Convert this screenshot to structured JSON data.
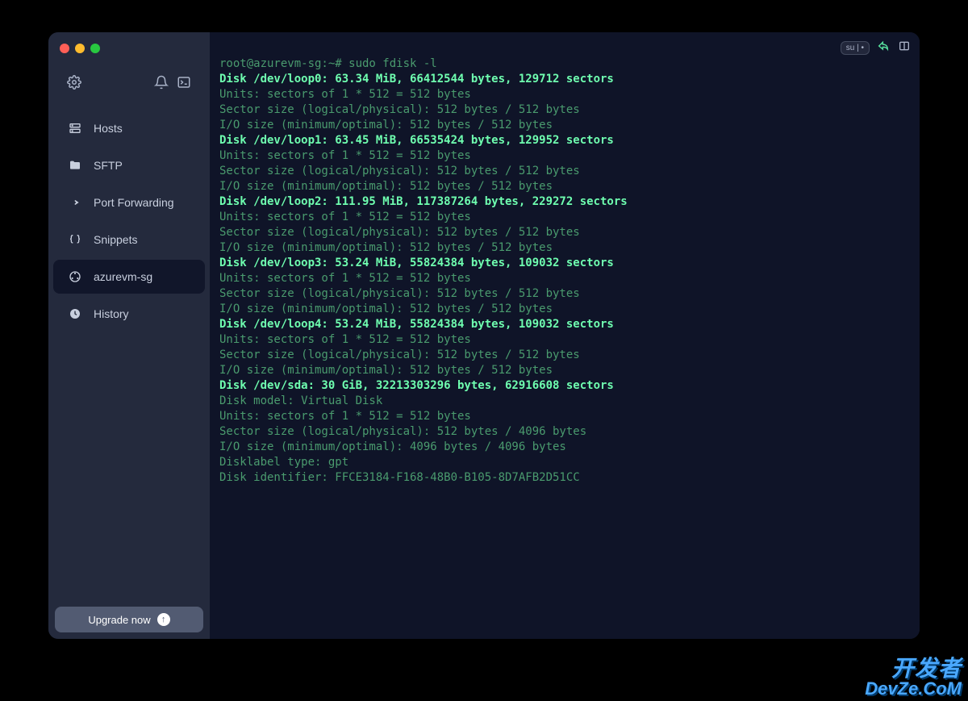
{
  "sidebar": {
    "items": [
      {
        "id": "hosts",
        "label": "Hosts"
      },
      {
        "id": "sftp",
        "label": "SFTP"
      },
      {
        "id": "port-forwarding",
        "label": "Port Forwarding"
      },
      {
        "id": "snippets",
        "label": "Snippets"
      },
      {
        "id": "session",
        "label": "azurevm-sg"
      },
      {
        "id": "history",
        "label": "History"
      }
    ],
    "upgrade_label": "Upgrade now"
  },
  "toolbar": {
    "chip_label": "su | •"
  },
  "terminal": {
    "prompt": "root@azurevm-sg:~# sudo fdisk -l",
    "blocks": [
      {
        "header": "Disk /dev/loop0: 63.34 MiB, 66412544 bytes, 129712 sectors",
        "lines": [
          "Units: sectors of 1 * 512 = 512 bytes",
          "Sector size (logical/physical): 512 bytes / 512 bytes",
          "I/O size (minimum/optimal): 512 bytes / 512 bytes"
        ]
      },
      {
        "header": "Disk /dev/loop1: 63.45 MiB, 66535424 bytes, 129952 sectors",
        "lines": [
          "Units: sectors of 1 * 512 = 512 bytes",
          "Sector size (logical/physical): 512 bytes / 512 bytes",
          "I/O size (minimum/optimal): 512 bytes / 512 bytes"
        ]
      },
      {
        "header": "Disk /dev/loop2: 111.95 MiB, 117387264 bytes, 229272 sectors",
        "lines": [
          "Units: sectors of 1 * 512 = 512 bytes",
          "Sector size (logical/physical): 512 bytes / 512 bytes",
          "I/O size (minimum/optimal): 512 bytes / 512 bytes"
        ]
      },
      {
        "header": "Disk /dev/loop3: 53.24 MiB, 55824384 bytes, 109032 sectors",
        "lines": [
          "Units: sectors of 1 * 512 = 512 bytes",
          "Sector size (logical/physical): 512 bytes / 512 bytes",
          "I/O size (minimum/optimal): 512 bytes / 512 bytes"
        ]
      },
      {
        "header": "Disk /dev/loop4: 53.24 MiB, 55824384 bytes, 109032 sectors",
        "lines": [
          "Units: sectors of 1 * 512 = 512 bytes",
          "Sector size (logical/physical): 512 bytes / 512 bytes",
          "I/O size (minimum/optimal): 512 bytes / 512 bytes"
        ]
      },
      {
        "header": "Disk /dev/sda: 30 GiB, 32213303296 bytes, 62916608 sectors",
        "lines": [
          "Disk model: Virtual Disk",
          "Units: sectors of 1 * 512 = 512 bytes",
          "Sector size (logical/physical): 512 bytes / 4096 bytes",
          "I/O size (minimum/optimal): 4096 bytes / 4096 bytes",
          "Disklabel type: gpt",
          "Disk identifier: FFCE3184-F168-48B0-B105-8D7AFB2D51CC"
        ]
      }
    ]
  },
  "watermark": {
    "line1": "开发者",
    "line2": "DevZe.CoM"
  }
}
